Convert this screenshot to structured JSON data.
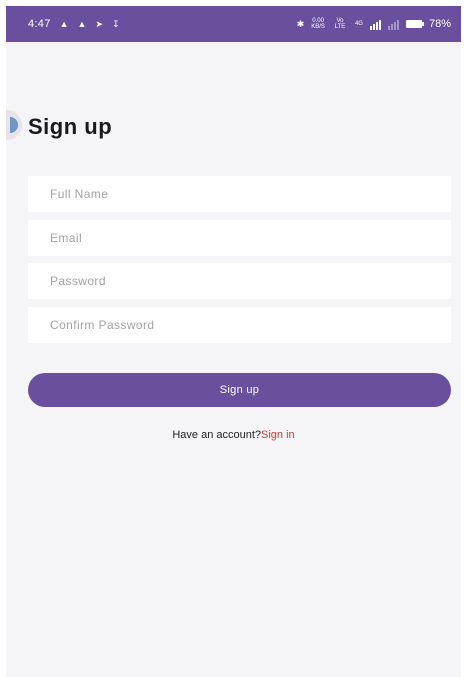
{
  "status_bar": {
    "time": "4:47",
    "left_icons": [
      "notification-icon",
      "notification-icon",
      "send-icon",
      "download-icon"
    ],
    "data_speed": "0.00",
    "data_unit": "KB/S",
    "volte": "Vo LTE",
    "network": "4G",
    "battery": "78%"
  },
  "page": {
    "title": "Sign up"
  },
  "form": {
    "full_name_placeholder": "Full Name",
    "email_placeholder": "Email",
    "password_placeholder": "Password",
    "confirm_password_placeholder": "Confirm Password",
    "submit_label": "Sign up"
  },
  "footer": {
    "prompt": "Have an account?",
    "link_label": "Sign in"
  },
  "colors": {
    "accent": "#6a4f9e",
    "link": "#d63a2f",
    "background": "#f5f4f7"
  }
}
